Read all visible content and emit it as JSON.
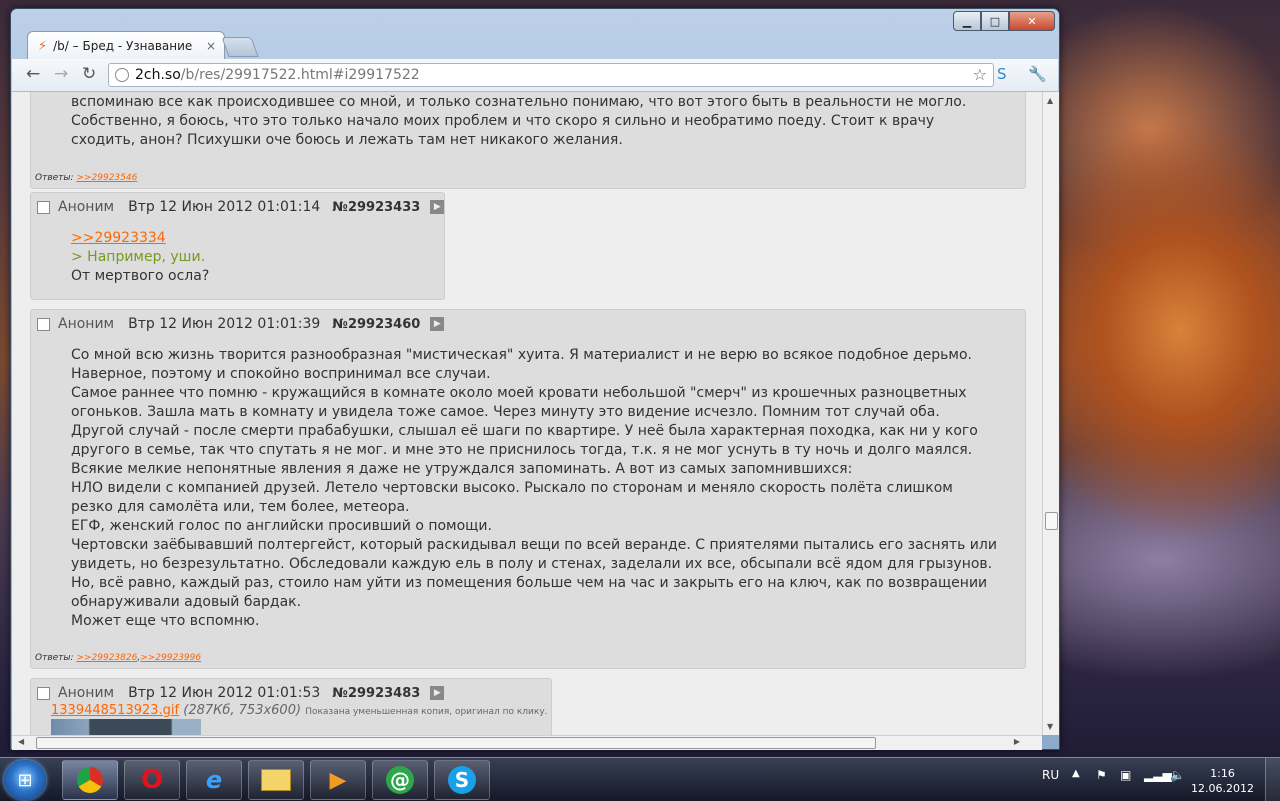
{
  "browser": {
    "tab_title": "/b/ – Бред - Узнавание",
    "tab_close": "×",
    "url_host": "2ch.so",
    "url_path": "/b/res/29917522.html#i29917522",
    "win_min": "▁",
    "win_max": "□",
    "win_close": "✕",
    "back": "←",
    "forward": "→",
    "reload": "↻",
    "star": "☆"
  },
  "thread": {
    "top_post": {
      "lines": [
        "вспоминаю все как происходившее со мной, и только сознательно понимаю, что вот этого быть в реальности не могло.",
        "Собственно, я боюсь, что это только начало моих проблем и что скоро я сильно и необратимо поеду. Стоит к врачу",
        "сходить, анон? Психушки оче боюсь и лежать там нет никакого желания."
      ],
      "answers_label": "Ответы:",
      "answers": [
        ">>29923546"
      ]
    },
    "post_433": {
      "author": "Аноним",
      "date": "Втр 12 Июн 2012 01:01:14",
      "number": "№29923433",
      "reply_link": ">>29923334",
      "quote": "> Например, уши.",
      "text": "От мертвого осла?"
    },
    "post_460": {
      "author": "Аноним",
      "date": "Втр 12 Июн 2012 01:01:39",
      "number": "№29923460",
      "lines": [
        "Со мной всю жизнь творится разнообразная \"мистическая\" хуита. Я материалист и не верю во всякое подобное дерьмо.",
        "Наверное, поэтому и спокойно воспринимал все случаи.",
        "Самое раннее что помню - кружащийся в комнате около моей кровати небольшой \"смерч\" из крошечных разноцветных",
        "огоньков. Зашла мать в комнату и увидела тоже самое. Через минуту это видение исчезло. Помним тот случай оба.",
        "Другой случай - после смерти прабабушки, слышал её шаги по квартире. У неё была характерная походка, как ни у кого",
        "другого в семье, так что спутать я не мог. и мне это не приснилось тогда, т.к. я не мог уснуть в ту ночь и долго маялся.",
        "Всякие мелкие непонятные явления я даже не утруждался запоминать. А вот из самых запомнившихся:",
        "НЛО видели с компанией друзей. Летело чертовски высоко. Рыскало по сторонам и меняло скорость полёта слишком",
        "резко для самолёта или, тем более, метеора.",
        "ЕГФ, женский голос по английски просивший о помощи.",
        "Чертовски заёбывавший полтергейст, который раскидывал вещи по всей веранде. С приятелями пытались его заснять или",
        "увидеть, но безрезультатно. Обследовали каждую ель в полу и стенах, заделали их все, обсыпали всё ядом для грызунов.",
        "Но, всё равно, каждый раз, стоило нам уйти из помещения больше чем на час и закрыть его на ключ, как по возвращении",
        "обнаруживали адовый бардак.",
        "Может еще что вспомню."
      ],
      "answers_label": "Ответы:",
      "answers": [
        ">>29923826",
        ">>29923996"
      ]
    },
    "post_483": {
      "author": "Аноним",
      "date": "Втр 12 Июн 2012 01:01:53",
      "number": "№29923483",
      "file_name": "1339448513923.gif",
      "file_meta": "(287Кб, 753x600)",
      "file_hint": "Показана уменьшенная копия, оригинал по клику."
    },
    "play_glyph": "▶"
  },
  "taskbar": {
    "start_glyph": "⊞",
    "lang": "RU",
    "time": "1:16",
    "date": "12.06.2012"
  },
  "colors": {
    "link": "#ff6600",
    "quote": "#789922",
    "post_bg": "#dddddd",
    "page_bg": "#eeeeee"
  }
}
